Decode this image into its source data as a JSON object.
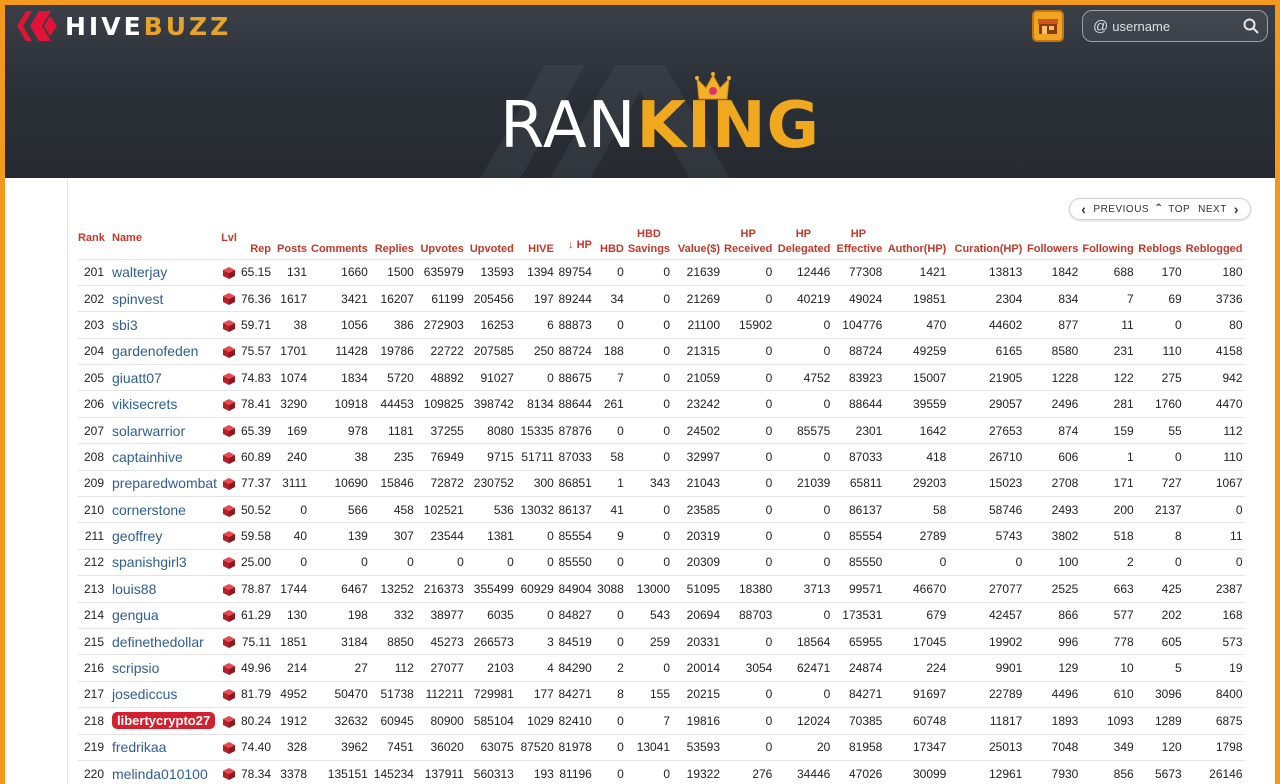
{
  "header": {
    "logo_hive": "HIVE",
    "logo_buzz": "BUZZ",
    "search_placeholder": "username",
    "title_white": "RAN",
    "title_gold": "KING",
    "icons": [
      "hive-logo-icon",
      "shop-icon",
      "at-icon",
      "search-icon",
      "crown-icon"
    ]
  },
  "pager": {
    "previous": "PREVIOUS",
    "top": "TOP",
    "next": "NEXT"
  },
  "colors": {
    "accent": "#f39a1e",
    "header_bg": "#2b3037",
    "headers_red": "#c0392b",
    "link_blue": "#2f5e94",
    "highlight_red": "#d2202f"
  },
  "columns": {
    "rank": "Rank",
    "name": "Name",
    "lvl": "Lvl",
    "rep": "Rep",
    "posts": "Posts",
    "comments": "Comments",
    "replies": "Replies",
    "upvotes": "Upvotes",
    "upvoted": "Upvoted",
    "hive": "HIVE",
    "hp": "HP",
    "hbd": "HBD",
    "hbd_savings_top": "HBD",
    "hbd_savings_bottom": "Savings",
    "value": "Value($)",
    "hp_received_top": "HP",
    "hp_received_bottom": "Received",
    "hp_delegated_top": "HP",
    "hp_delegated_bottom": "Delegated",
    "hp_effective_top": "HP",
    "hp_effective_bottom": "Effective",
    "author": "Author(HP)",
    "curation": "Curation(HP)",
    "followers": "Followers",
    "following": "Following",
    "reblogs": "Reblogs",
    "reblogged": "Reblogged",
    "sort_arrow": "↓"
  },
  "rows": [
    [
      "201",
      "walterjay",
      "65.15",
      "131",
      "1660",
      "1500",
      "635979",
      "13593",
      "1394",
      "89754",
      "0",
      "0",
      "21639",
      "0",
      "12446",
      "77308",
      "1421",
      "13813",
      "1842",
      "688",
      "170",
      "180"
    ],
    [
      "202",
      "spinvest",
      "76.36",
      "1617",
      "3421",
      "16207",
      "61199",
      "205456",
      "197",
      "89244",
      "34",
      "0",
      "21269",
      "0",
      "40219",
      "49024",
      "19851",
      "2304",
      "834",
      "7",
      "69",
      "3736"
    ],
    [
      "203",
      "sbi3",
      "59.71",
      "38",
      "1056",
      "386",
      "272903",
      "16253",
      "6",
      "88873",
      "0",
      "0",
      "21100",
      "15902",
      "0",
      "104776",
      "470",
      "44602",
      "877",
      "11",
      "0",
      "80"
    ],
    [
      "204",
      "gardenofeden",
      "75.57",
      "1701",
      "11428",
      "19786",
      "22722",
      "207585",
      "250",
      "88724",
      "188",
      "0",
      "21315",
      "0",
      "0",
      "88724",
      "49259",
      "6165",
      "8580",
      "231",
      "110",
      "4158"
    ],
    [
      "205",
      "giuatt07",
      "74.83",
      "1074",
      "1834",
      "5720",
      "48892",
      "91027",
      "0",
      "88675",
      "7",
      "0",
      "21059",
      "0",
      "4752",
      "83923",
      "15007",
      "21905",
      "1228",
      "122",
      "275",
      "942"
    ],
    [
      "206",
      "vikisecrets",
      "78.41",
      "3290",
      "10918",
      "44453",
      "109825",
      "398742",
      "8134",
      "88644",
      "261",
      "0",
      "23242",
      "0",
      "0",
      "88644",
      "39559",
      "29057",
      "2496",
      "281",
      "1760",
      "4470"
    ],
    [
      "207",
      "solarwarrior",
      "65.39",
      "169",
      "978",
      "1181",
      "37255",
      "8080",
      "15335",
      "87876",
      "0",
      "0",
      "24502",
      "0",
      "85575",
      "2301",
      "1642",
      "27653",
      "874",
      "159",
      "55",
      "112"
    ],
    [
      "208",
      "captainhive",
      "60.89",
      "240",
      "38",
      "235",
      "76949",
      "9715",
      "51711",
      "87033",
      "58",
      "0",
      "32997",
      "0",
      "0",
      "87033",
      "418",
      "26710",
      "606",
      "1",
      "0",
      "110"
    ],
    [
      "209",
      "preparedwombat",
      "77.37",
      "3111",
      "10690",
      "15846",
      "72872",
      "230752",
      "300",
      "86851",
      "1",
      "343",
      "21043",
      "0",
      "21039",
      "65811",
      "29203",
      "15023",
      "2708",
      "171",
      "727",
      "1067"
    ],
    [
      "210",
      "cornerstone",
      "50.52",
      "0",
      "566",
      "458",
      "102521",
      "536",
      "13032",
      "86137",
      "41",
      "0",
      "23585",
      "0",
      "0",
      "86137",
      "58",
      "58746",
      "2493",
      "200",
      "2137",
      "0"
    ],
    [
      "211",
      "geoffrey",
      "59.58",
      "40",
      "139",
      "307",
      "23544",
      "1381",
      "0",
      "85554",
      "9",
      "0",
      "20319",
      "0",
      "0",
      "85554",
      "2789",
      "5743",
      "3802",
      "518",
      "8",
      "11"
    ],
    [
      "212",
      "spanishgirl3",
      "25.00",
      "0",
      "0",
      "0",
      "0",
      "0",
      "0",
      "85550",
      "0",
      "0",
      "20309",
      "0",
      "0",
      "85550",
      "0",
      "0",
      "100",
      "2",
      "0",
      "0"
    ],
    [
      "213",
      "louis88",
      "78.87",
      "1744",
      "6467",
      "13252",
      "216373",
      "355499",
      "60929",
      "84904",
      "3088",
      "13000",
      "51095",
      "18380",
      "3713",
      "99571",
      "46670",
      "27077",
      "2525",
      "663",
      "425",
      "2387"
    ],
    [
      "214",
      "gengua",
      "61.29",
      "130",
      "198",
      "332",
      "38977",
      "6035",
      "0",
      "84827",
      "0",
      "543",
      "20694",
      "88703",
      "0",
      "173531",
      "679",
      "42457",
      "866",
      "577",
      "202",
      "168"
    ],
    [
      "215",
      "definethedollar",
      "75.11",
      "1851",
      "3184",
      "8850",
      "45273",
      "266573",
      "3",
      "84519",
      "0",
      "259",
      "20331",
      "0",
      "18564",
      "65955",
      "17045",
      "19902",
      "996",
      "778",
      "605",
      "573"
    ],
    [
      "216",
      "scripsio",
      "49.96",
      "214",
      "27",
      "112",
      "27077",
      "2103",
      "4",
      "84290",
      "2",
      "0",
      "20014",
      "3054",
      "62471",
      "24874",
      "224",
      "9901",
      "129",
      "10",
      "5",
      "19"
    ],
    [
      "217",
      "josediccus",
      "81.79",
      "4952",
      "50470",
      "51738",
      "112211",
      "729981",
      "177",
      "84271",
      "8",
      "155",
      "20215",
      "0",
      "0",
      "84271",
      "91697",
      "22789",
      "4496",
      "610",
      "3096",
      "8400"
    ],
    [
      "218",
      "libertycrypto27",
      "80.24",
      "1912",
      "32632",
      "60945",
      "80900",
      "585104",
      "1029",
      "82410",
      "0",
      "7",
      "19816",
      "0",
      "12024",
      "70385",
      "60748",
      "11817",
      "1893",
      "1093",
      "1289",
      "6875"
    ],
    [
      "219",
      "fredrikaa",
      "74.40",
      "328",
      "3962",
      "7451",
      "36020",
      "63075",
      "87520",
      "81978",
      "0",
      "13041",
      "53593",
      "0",
      "20",
      "81958",
      "17347",
      "25013",
      "7048",
      "349",
      "120",
      "1798"
    ],
    [
      "220",
      "melinda010100",
      "78.34",
      "3378",
      "135151",
      "145234",
      "137911",
      "560313",
      "193",
      "81196",
      "0",
      "0",
      "19322",
      "276",
      "34446",
      "47026",
      "30099",
      "12961",
      "7930",
      "856",
      "5673",
      "26146"
    ]
  ],
  "highlighted_user": "libertycrypto27"
}
